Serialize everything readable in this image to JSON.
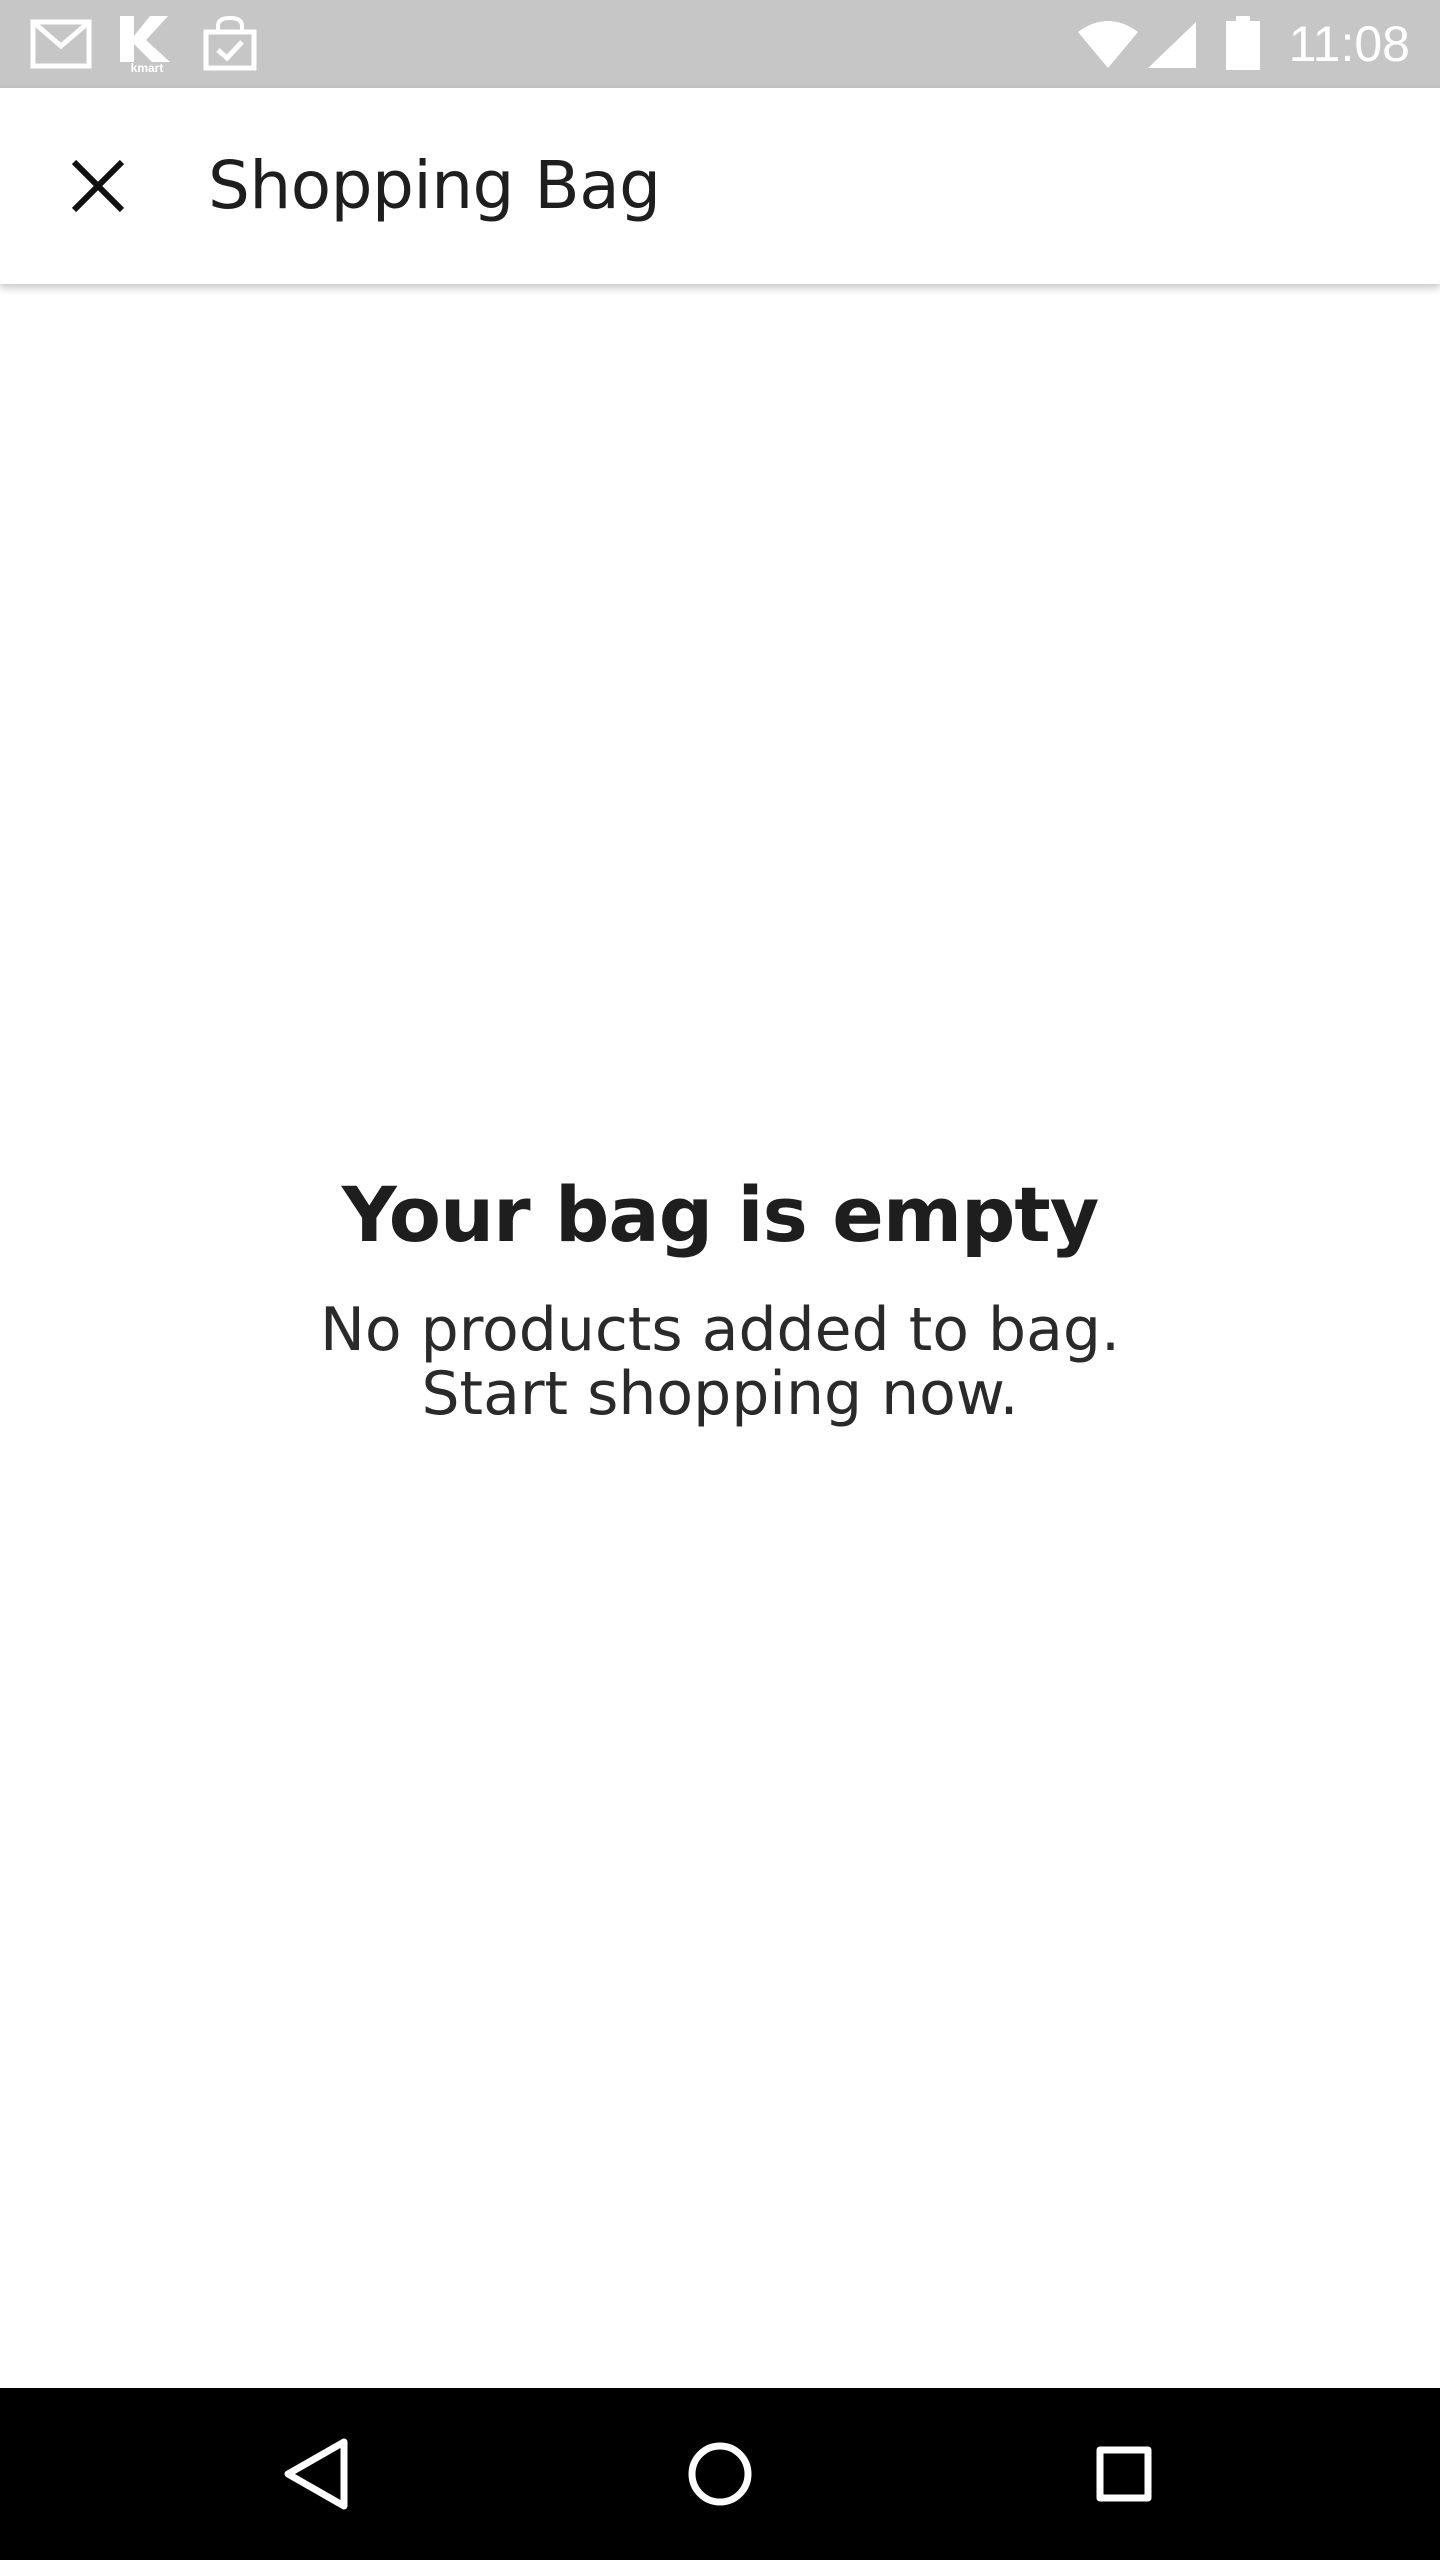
{
  "status_bar": {
    "time": "11:08",
    "notification_icons": [
      "gmail-icon",
      "kmart-app-icon",
      "shopping-bag-check-icon"
    ],
    "kmart_icon_text": "kmart",
    "system_icons": [
      "wifi-icon",
      "cellular-signal-icon",
      "battery-icon"
    ]
  },
  "app_bar": {
    "title": "Shopping Bag",
    "close_icon": "close-icon"
  },
  "empty_state": {
    "title": "Your bag is empty",
    "subtitle_line1": "No products added to bag.",
    "subtitle_line2": "Start shopping now."
  },
  "nav_bar": {
    "buttons": [
      "back-triangle-icon",
      "home-circle-icon",
      "recents-square-icon"
    ]
  },
  "colors": {
    "status_bar_bg": "#c6c6c6",
    "app_bar_bg": "#ffffff",
    "text_primary": "#1e1e1e",
    "nav_bar_bg": "#000000"
  }
}
